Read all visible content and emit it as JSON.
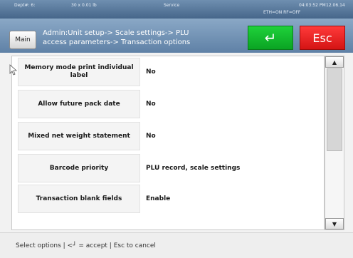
{
  "status": {
    "dept": "Dept#: 6:",
    "scale": "30 x 0.01 lb",
    "mode": "Service",
    "time": "04:03:52 PM",
    "date": "12.06.14",
    "network": "ETH=ON RF=OFF"
  },
  "header": {
    "main_label": "Main",
    "breadcrumb_line1": "Admin:Unit setup-> Scale settings-> PLU",
    "breadcrumb_line2": "access parameters-> Transaction options",
    "accept_symbol": "↵",
    "esc_label": "Esc"
  },
  "options": [
    {
      "label": "Memory mode print individual label",
      "value": "No"
    },
    {
      "label": "Allow future pack date",
      "value": "No"
    },
    {
      "label": "Mixed net weight statement",
      "value": "No"
    },
    {
      "label": "Barcode priority",
      "value": "PLU record, scale settings"
    },
    {
      "label": "Transaction blank fields",
      "value": "Enable"
    }
  ],
  "scrollbar": {
    "up_symbol": "▲",
    "down_symbol": "▼"
  },
  "footer": {
    "hint": "Select options | <┘ = accept | Esc to cancel"
  },
  "colors": {
    "accept": "#0fb82a",
    "esc": "#e41b1b",
    "header": "#6f8fb0"
  }
}
